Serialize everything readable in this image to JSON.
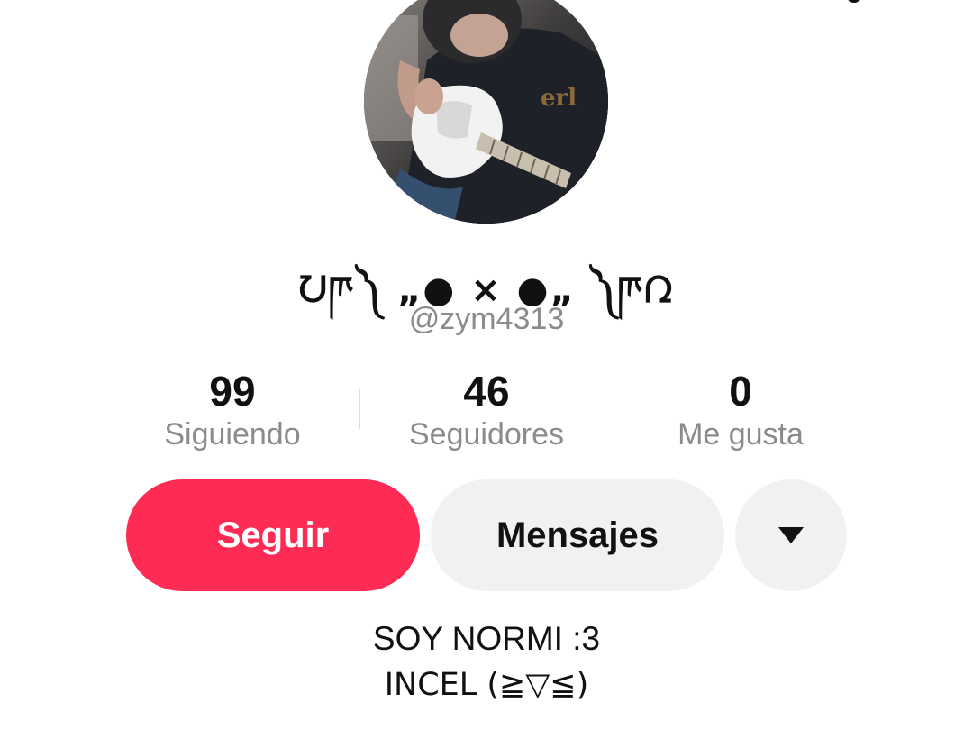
{
  "profile": {
    "display_name": "ᘢཫ༽ „● × ●„ ༽ཫᘣ",
    "handle": "@zym4313",
    "avatar_description": "profile photo"
  },
  "stats": [
    {
      "value": "99",
      "label": "Siguiendo"
    },
    {
      "value": "46",
      "label": "Seguidores"
    },
    {
      "value": "0",
      "label": "Me gusta"
    }
  ],
  "actions": {
    "follow_label": "Seguir",
    "messages_label": "Mensajes",
    "more_icon": "triangle-down-icon"
  },
  "bio": {
    "line1": "SOY NORMI :3",
    "line2": "INCEL (≧▽≦)"
  },
  "colors": {
    "follow_button": "#fe2c55",
    "secondary_button": "#f1f1f2",
    "muted_text": "#8a8a8f",
    "text": "#111111"
  }
}
